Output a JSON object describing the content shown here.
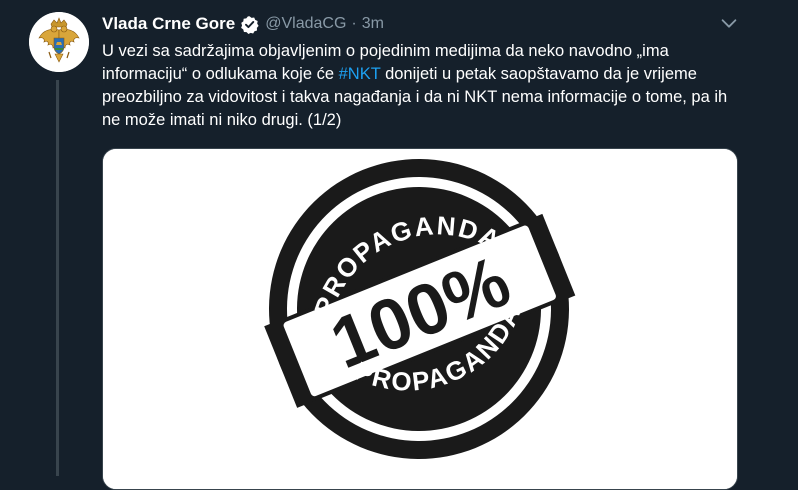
{
  "tweet": {
    "author_name": "Vlada Crne Gore",
    "handle": "@VladaCG",
    "separator": "·",
    "time": "3m",
    "text_before": "U vezi sa sadržajima objavljenim o pojedinim medijima da neko navodno „ima informaciju“ o odlukama koje će ",
    "hashtag": "#NKT",
    "text_after": " donijeti u petak saopštavamo da je vrijeme preozbiljno za vidovitost i takva nagađanja i da ni NKT nema informacije o tome, pa ih ne može imati ni niko drugi. (1/2)"
  },
  "media": {
    "stamp_top_text": "PROPAGANDA",
    "stamp_center_text": "100%",
    "stamp_bottom_text": "PROPAGANDA"
  },
  "icons": {
    "avatar": "montenegro-coat-of-arms",
    "verified": "verified-badge-icon",
    "menu": "chevron-down-icon"
  },
  "colors": {
    "background": "#15202b",
    "hashtag": "#1da1f2",
    "secondary_text": "#8899a6",
    "verified_badge": "#ffffff"
  }
}
